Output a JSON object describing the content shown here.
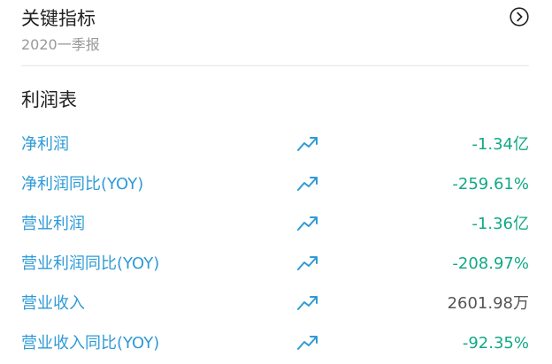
{
  "header": {
    "title": "关键指标",
    "subtitle": "2020一季报",
    "action_icon": "chevron-right-circle-icon"
  },
  "section": {
    "title": "利润表"
  },
  "rows": [
    {
      "label": "净利润",
      "value": "-1.34亿",
      "tone": "up",
      "icon": "trend-up-icon"
    },
    {
      "label": "净利润同比(YOY)",
      "value": "-259.61%",
      "tone": "up",
      "icon": "trend-up-icon"
    },
    {
      "label": "营业利润",
      "value": "-1.36亿",
      "tone": "up",
      "icon": "trend-up-icon"
    },
    {
      "label": "营业利润同比(YOY)",
      "value": "-208.97%",
      "tone": "up",
      "icon": "trend-up-icon"
    },
    {
      "label": "营业收入",
      "value": "2601.98万",
      "tone": "plain",
      "icon": "trend-up-icon"
    },
    {
      "label": "营业收入同比(YOY)",
      "value": "-92.35%",
      "tone": "up",
      "icon": "trend-up-icon"
    }
  ],
  "colors": {
    "label": "#2e9ad6",
    "positive": "#11a985",
    "neutral": "#555555"
  }
}
